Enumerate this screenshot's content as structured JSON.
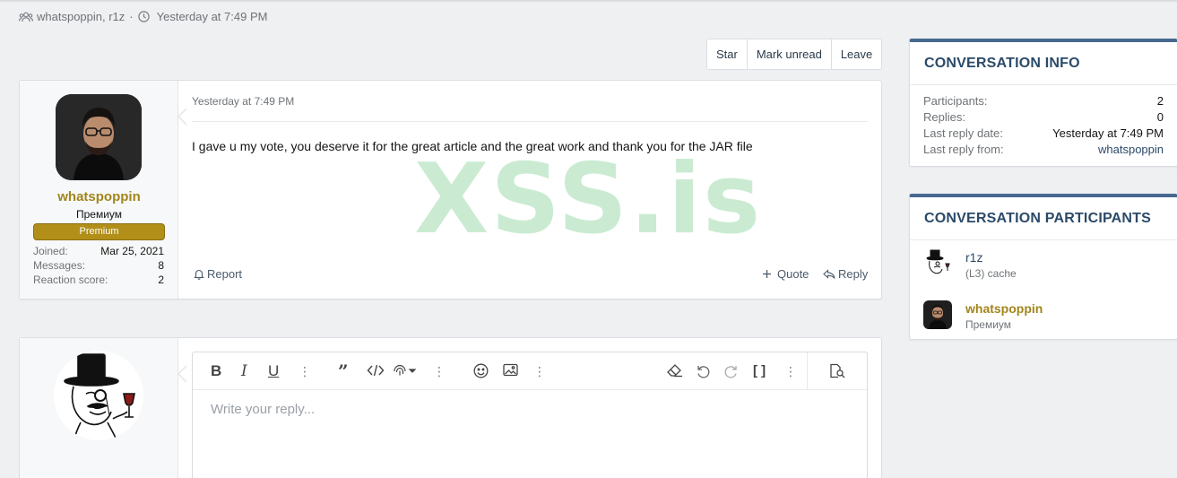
{
  "conversation": {
    "participants_text": "whatspoppin, r1z",
    "separator": "·",
    "time_text": "Yesterday at 7:49 PM"
  },
  "actions": {
    "star": "Star",
    "mark_unread": "Mark unread",
    "leave": "Leave"
  },
  "message": {
    "author": "whatspoppin",
    "user_title": "Премиум",
    "badge": "Premium",
    "stats": [
      {
        "label": "Joined:",
        "value": "Mar 25, 2021"
      },
      {
        "label": "Messages:",
        "value": "8"
      },
      {
        "label": "Reaction score:",
        "value": "2"
      }
    ],
    "date": "Yesterday at 7:49 PM",
    "body": "I gave u my vote, you deserve it for the great article and the great work and thank you for the JAR file",
    "watermark": "XSS.is",
    "report": "Report",
    "quote": "Quote",
    "reply": "Reply"
  },
  "editor": {
    "placeholder": "Write your reply..."
  },
  "info_panel": {
    "title": "CONVERSATION INFO",
    "rows": [
      {
        "label": "Participants:",
        "value": "2"
      },
      {
        "label": "Replies:",
        "value": "0"
      },
      {
        "label": "Last reply date:",
        "value": "Yesterday at 7:49 PM"
      },
      {
        "label": "Last reply from:",
        "value": "whatspoppin"
      }
    ]
  },
  "participants_panel": {
    "title": "CONVERSATION PARTICIPANTS",
    "items": [
      {
        "name": "r1z",
        "subtitle": "(L3) cache"
      },
      {
        "name": "whatspoppin",
        "subtitle": "Премиум"
      }
    ]
  },
  "colors": {
    "accent": "#47698f",
    "gold": "#a2851b",
    "badge": "#b18f19"
  }
}
